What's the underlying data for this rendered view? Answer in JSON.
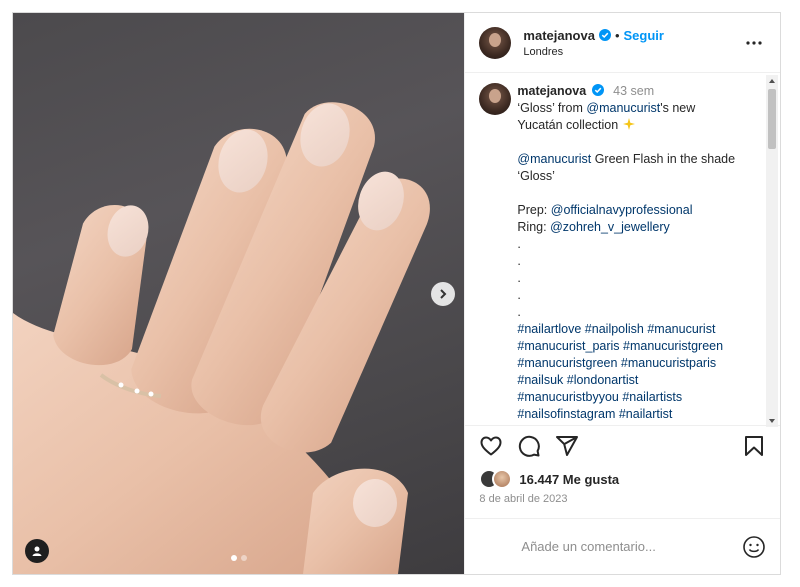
{
  "post": {
    "username": "matejanova",
    "follow_label": "Seguir",
    "location": "Londres",
    "time_ago": "43 sem",
    "likes": "16.447 Me gusta",
    "date": "8 de abril de 2023",
    "comment_placeholder": "Añade un comentario...",
    "carousel_count": 2,
    "carousel_active": 1
  },
  "caption": {
    "l1a": "‘Gloss’ from ",
    "l1b": "@manucurist",
    "l1c": "'s new",
    "l2": "Yucatán collection ",
    "l4a": "@manucurist",
    "l4b": " Green Flash in the shade",
    "l5": "‘Gloss’",
    "prep_label": "Prep: ",
    "prep_link": "@officialnavyprofessional",
    "ring_label": "Ring: ",
    "ring_link": "@zohreh_v_jewellery",
    "dot": ".",
    "tags": [
      "#nailartlove #nailpolish #manucurist",
      "#manucurist_paris #manucuristgreen",
      "#manucuristgreen #manucuristparis",
      "#nailsuk #londonartist",
      "#manucuristbyyou #nailartists",
      "#nailsofinstagram #nailartist"
    ]
  },
  "icons": {
    "verified": "verified-badge-icon",
    "more": "more-options-icon",
    "like": "heart-icon",
    "comment": "comment-icon",
    "share": "share-icon",
    "save": "bookmark-icon",
    "emoji": "emoji-icon",
    "next": "chevron-right-icon",
    "tags": "user-tag-icon",
    "sparkle": "sparkles-icon"
  },
  "colors": {
    "accent": "#0095f6",
    "link": "#00376b",
    "verified": "#0095f6"
  }
}
